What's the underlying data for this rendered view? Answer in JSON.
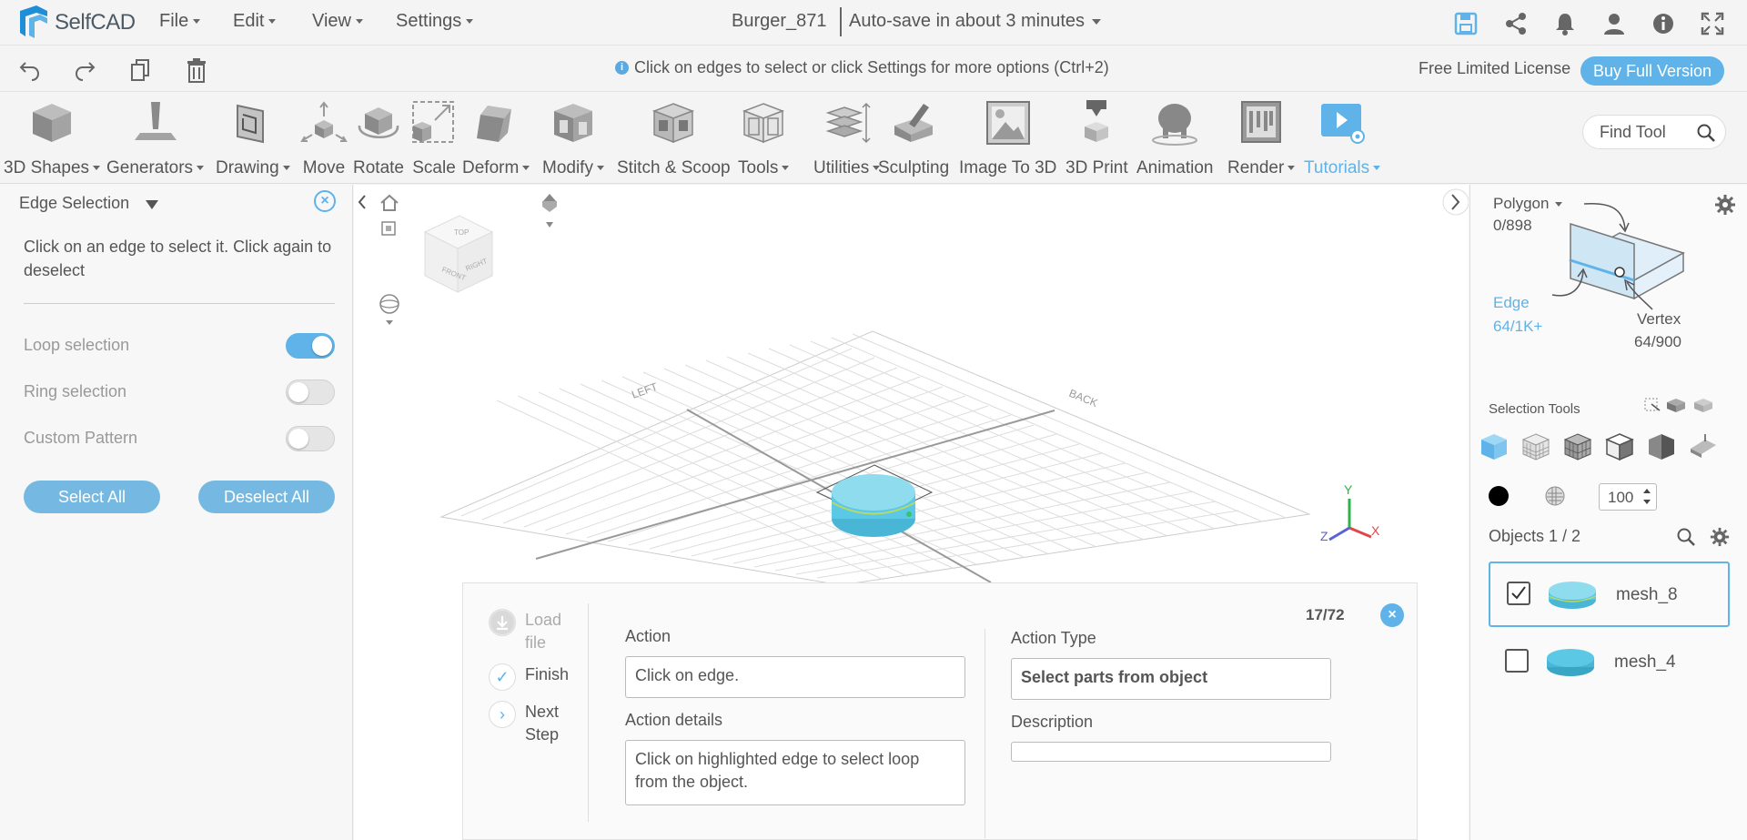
{
  "app": {
    "name": "SelfCAD"
  },
  "menus": [
    "File",
    "Edit",
    "View",
    "Settings"
  ],
  "document": {
    "title": "Burger_871",
    "autosave": "Auto-save in about 3 minutes"
  },
  "hint": "Click on edges to select or click Settings for more options (Ctrl+2)",
  "license": {
    "text": "Free Limited License",
    "buy_label": "Buy Full Version"
  },
  "tools": [
    {
      "label": "3D Shapes",
      "dropdown": true
    },
    {
      "label": "Generators",
      "dropdown": true
    },
    {
      "label": "Drawing",
      "dropdown": true
    },
    {
      "label": "Move"
    },
    {
      "label": "Rotate"
    },
    {
      "label": "Scale"
    },
    {
      "label": "Deform",
      "dropdown": true
    },
    {
      "label": "Modify",
      "dropdown": true
    },
    {
      "label": "Stitch & Scoop"
    },
    {
      "label": "Tools",
      "dropdown": true
    },
    {
      "label": "Utilities",
      "dropdown": true
    },
    {
      "label": "Sculpting"
    },
    {
      "label": "Image To 3D"
    },
    {
      "label": "3D Print"
    },
    {
      "label": "Animation"
    },
    {
      "label": "Render",
      "dropdown": true
    },
    {
      "label": "Tutorials",
      "dropdown": true
    }
  ],
  "find_tool": {
    "placeholder": "Find Tool"
  },
  "left_panel": {
    "title": "Edge Selection",
    "description": "Click on an edge to select it. Click again to deselect",
    "options": [
      {
        "label": "Loop selection",
        "on": true
      },
      {
        "label": "Ring selection",
        "on": false
      },
      {
        "label": "Custom Pattern",
        "on": false
      }
    ],
    "select_all": "Select All",
    "deselect_all": "Deselect All"
  },
  "viewport": {
    "cube_labels": {
      "top": "TOP",
      "front": "FRONT",
      "right": "RIGHT"
    },
    "grid_labels": {
      "left": "LEFT",
      "back": "BACK"
    },
    "axes": {
      "x": "X",
      "y": "Y",
      "z": "Z"
    }
  },
  "right_panel": {
    "mode": "Polygon",
    "polygon_count": "0/898",
    "edge_label": "Edge",
    "edge_count": "64/1K+",
    "vertex_label": "Vertex",
    "vertex_count": "64/900",
    "selection_tools_label": "Selection Tools",
    "opacity_value": "100",
    "objects_label": "Objects 1 / 2",
    "objects": [
      {
        "name": "mesh_8",
        "checked": true,
        "selected": true
      },
      {
        "name": "mesh_4",
        "checked": false,
        "selected": false
      }
    ]
  },
  "action_panel": {
    "steps": [
      "Load file",
      "Finish",
      "Next Step"
    ],
    "counter": "17/72",
    "action_label": "Action",
    "action_value": "Click on edge.",
    "action_details_label": "Action details",
    "action_details_value": "Click on highlighted edge to select loop from the object.",
    "action_type_label": "Action Type",
    "action_type_value": "Select parts from object",
    "description_label": "Description",
    "description_value": ""
  },
  "colors": {
    "accent": "#5fb3e8",
    "object": "#5bc8e6"
  }
}
